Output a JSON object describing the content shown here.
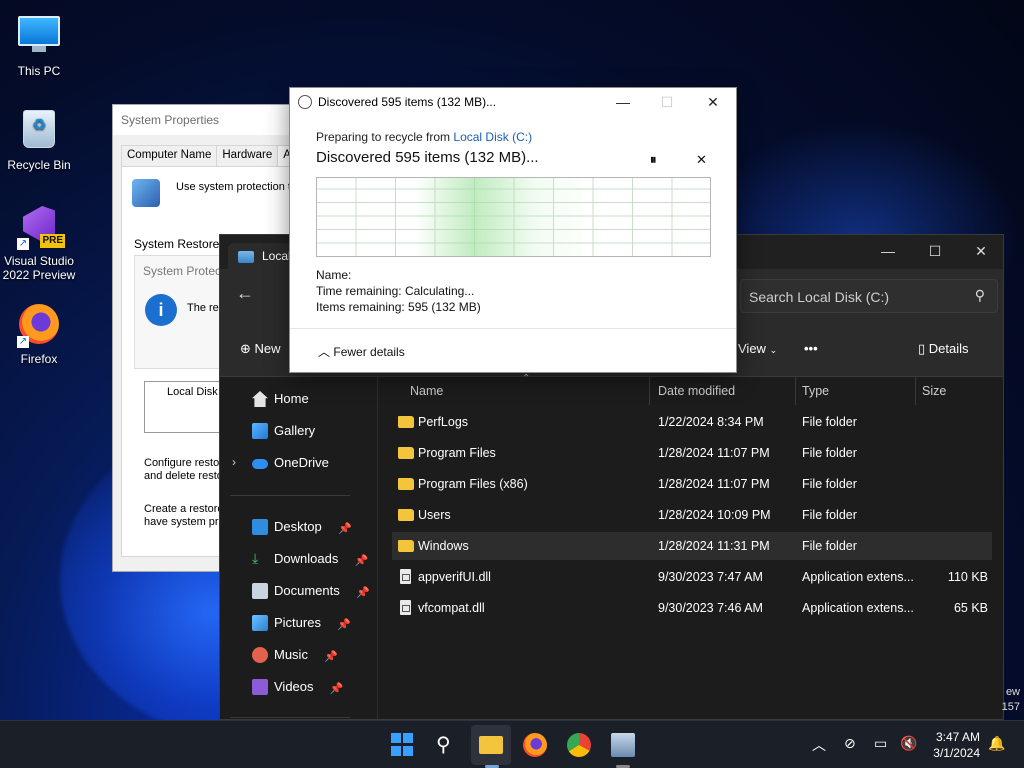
{
  "desktop": {
    "icons": [
      {
        "label": "This PC"
      },
      {
        "label": "Recycle Bin"
      },
      {
        "label": "Visual Studio 2022 Preview",
        "badge": "PRE"
      },
      {
        "label": "Firefox"
      }
    ],
    "corner_text": [
      "ew",
      "157"
    ]
  },
  "system_properties": {
    "title": "System Properties",
    "tabs": [
      "Computer Name",
      "Hardware",
      "Adv"
    ],
    "protection_text": "Use system protection to",
    "system_restore_label": "System Restore",
    "group_header": "System Protec",
    "info_text": "The re",
    "list_item": "Local Disk",
    "configure_text_1": "Configure restor",
    "configure_text_2": "and delete resto",
    "create_text_1": "Create a restore",
    "create_text_2": "have system pro"
  },
  "explorer": {
    "tab_label": "Local",
    "search_placeholder": "Search Local Disk (C:)",
    "commands": {
      "new": "New",
      "view": "View",
      "more": "•••",
      "details": "Details"
    },
    "nav": [
      {
        "label": "Home",
        "pinned": false
      },
      {
        "label": "Gallery",
        "pinned": false
      },
      {
        "label": "OneDrive",
        "pinned": false
      },
      {
        "label": "Desktop",
        "pinned": true
      },
      {
        "label": "Downloads",
        "pinned": true
      },
      {
        "label": "Documents",
        "pinned": true
      },
      {
        "label": "Pictures",
        "pinned": true
      },
      {
        "label": "Music",
        "pinned": true
      },
      {
        "label": "Videos",
        "pinned": true
      }
    ],
    "columns": [
      "Name",
      "Date modified",
      "Type",
      "Size"
    ],
    "files": [
      {
        "name": "PerfLogs",
        "date": "1/22/2024 8:34 PM",
        "type": "File folder",
        "size": "",
        "kind": "folder"
      },
      {
        "name": "Program Files",
        "date": "1/28/2024 11:07 PM",
        "type": "File folder",
        "size": "",
        "kind": "folder"
      },
      {
        "name": "Program Files (x86)",
        "date": "1/28/2024 11:07 PM",
        "type": "File folder",
        "size": "",
        "kind": "folder"
      },
      {
        "name": "Users",
        "date": "1/28/2024 10:09 PM",
        "type": "File folder",
        "size": "",
        "kind": "folder"
      },
      {
        "name": "Windows",
        "date": "1/28/2024 11:31 PM",
        "type": "File folder",
        "size": "",
        "kind": "folder",
        "selected": true
      },
      {
        "name": "appverifUI.dll",
        "date": "9/30/2023 7:47 AM",
        "type": "Application extens...",
        "size": "110 KB",
        "kind": "file"
      },
      {
        "name": "vfcompat.dll",
        "date": "9/30/2023 7:46 AM",
        "type": "Application extens...",
        "size": "65 KB",
        "kind": "file"
      }
    ]
  },
  "progress_dialog": {
    "title": "Discovered 595 items (132 MB)...",
    "preparing_prefix": "Preparing to recycle from ",
    "preparing_link": "Local Disk (C:)",
    "heading": "Discovered 595 items (132 MB)...",
    "name_label": "Name:",
    "time_label": "Time remaining:",
    "time_value": "Calculating...",
    "items_label": "Items remaining:",
    "items_value": "595 (132 MB)",
    "fewer_details": "Fewer details"
  },
  "taskbar": {
    "time": "3:47 AM",
    "date": "3/1/2024"
  },
  "colors": {
    "accent": "#3aa0ff",
    "folder": "#f2c53d",
    "link": "#1a5fb4"
  }
}
